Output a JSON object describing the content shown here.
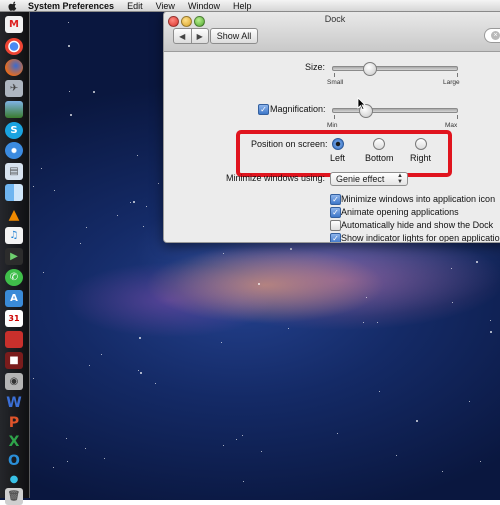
{
  "menubar": {
    "app_name": "System Preferences",
    "items": [
      "Edit",
      "View",
      "Window",
      "Help"
    ]
  },
  "dock_icons": [
    "chrome-icon",
    "firefox-icon",
    "safari-icon",
    "finder-icon",
    "skype-icon",
    "system-preferences-icon",
    "calendar-icon",
    "vlc-icon",
    "itunes-icon",
    "facetime-icon",
    "whatsapp-icon",
    "trash-icon"
  ],
  "window": {
    "title": "Dock",
    "show_all_label": "Show All",
    "size": {
      "label": "Size:",
      "min_label": "Small",
      "max_label": "Large",
      "value": 0.3
    },
    "magnification": {
      "label": "Magnification:",
      "checked": true,
      "min_label": "Min",
      "max_label": "Max",
      "value": 0.25
    },
    "position": {
      "label": "Position on screen:",
      "options": [
        {
          "label": "Left",
          "selected": true
        },
        {
          "label": "Bottom",
          "selected": false
        },
        {
          "label": "Right",
          "selected": false
        }
      ]
    },
    "minimize": {
      "label": "Minimize windows using:",
      "value": "Genie effect"
    },
    "checkboxes": [
      {
        "label": "Minimize windows into application icon",
        "checked": true
      },
      {
        "label": "Animate opening applications",
        "checked": true
      },
      {
        "label": "Automatically hide and show the Dock",
        "checked": false
      },
      {
        "label": "Show indicator lights for open applications",
        "checked": true
      }
    ]
  },
  "colors": {
    "highlight": "#e0141e",
    "accent": "#3d77c9"
  }
}
